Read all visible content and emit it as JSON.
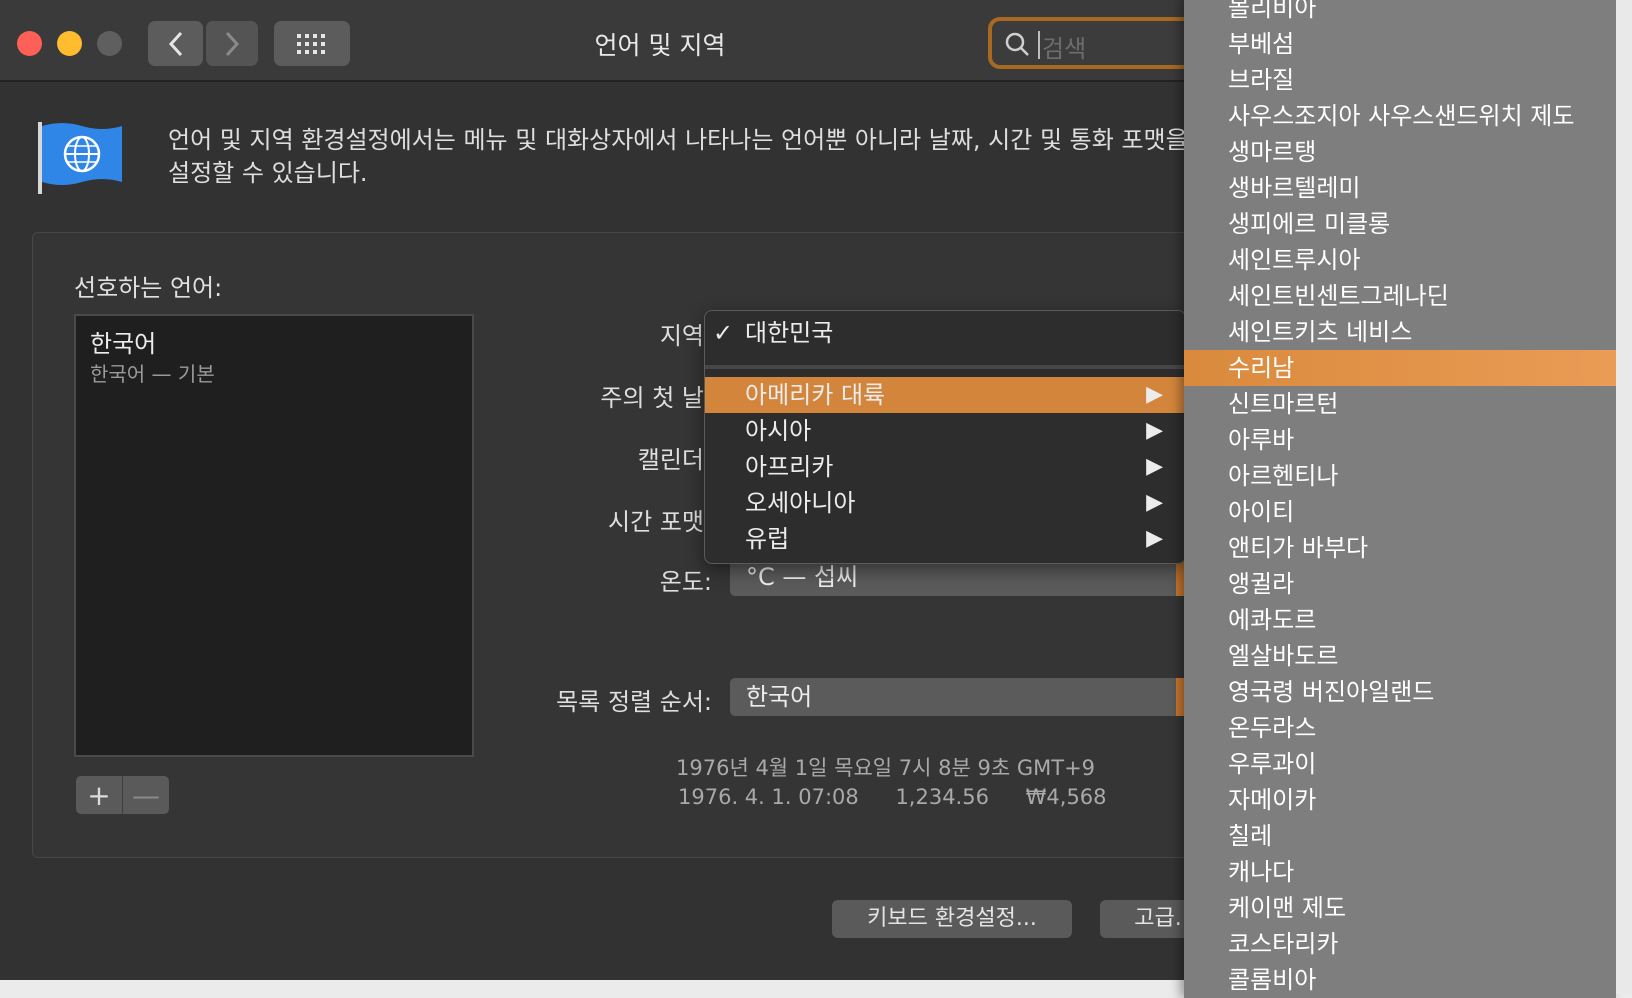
{
  "window": {
    "title": "언어 및 지역",
    "search_placeholder": "검색",
    "intro_line1": "언어 및 지역 환경설정에서는 메뉴 및 대화상자에서 나타나는 언어뿐 아니라 날짜, 시간 및 통화 포맷을",
    "intro_line2": "설정할 수 있습니다."
  },
  "languages": {
    "label": "선호하는 언어:",
    "items": [
      {
        "name": "한국어",
        "sub": "한국어 — 기본"
      }
    ],
    "add_label": "+",
    "remove_label": "—"
  },
  "fields": {
    "region_label": "지역",
    "first_day_label": "주의 첫 날",
    "calendar_label": "캘린더",
    "time_format_label": "시간 포맷",
    "temperature_label": "온도:",
    "temperature_value": "°C — 섭씨",
    "sort_label": "목록 정렬 순서:",
    "sort_value": "한국어"
  },
  "format_preview": {
    "line1": "1976년 4월 1일 목요일 7시 8분 9초 GMT+9",
    "date": "1976. 4. 1. 07:08",
    "number": "1,234.56",
    "currency": "₩4,568"
  },
  "buttons": {
    "keyboard": "키보드 환경설정...",
    "advanced": "고급..."
  },
  "region_menu": {
    "checked": "대한민국",
    "checkmark": "✓",
    "continents": [
      {
        "label": "아메리카 대륙",
        "selected": true
      },
      {
        "label": "아시아",
        "selected": false
      },
      {
        "label": "아프리카",
        "selected": false
      },
      {
        "label": "오세아니아",
        "selected": false
      },
      {
        "label": "유럽",
        "selected": false
      }
    ],
    "arrow": "▶"
  },
  "country_menu": {
    "items": [
      "볼리비아",
      "부베섬",
      "브라질",
      "사우스조지아 사우스샌드위치 제도",
      "생마르탱",
      "생바르텔레미",
      "생피에르 미클롱",
      "세인트루시아",
      "세인트빈센트그레나딘",
      "세인트키츠 네비스",
      "수리남",
      "신트마르턴",
      "아루바",
      "아르헨티나",
      "아이티",
      "앤티가 바부다",
      "앵귈라",
      "에콰도르",
      "엘살바도르",
      "영국령 버진아일랜드",
      "온두라스",
      "우루과이",
      "자메이카",
      "칠레",
      "캐나다",
      "케이맨 제도",
      "코스타리카",
      "콜롬비아"
    ],
    "selected_index": 10
  },
  "colors": {
    "accent": "#d2853b",
    "window_bg": "#323232"
  }
}
